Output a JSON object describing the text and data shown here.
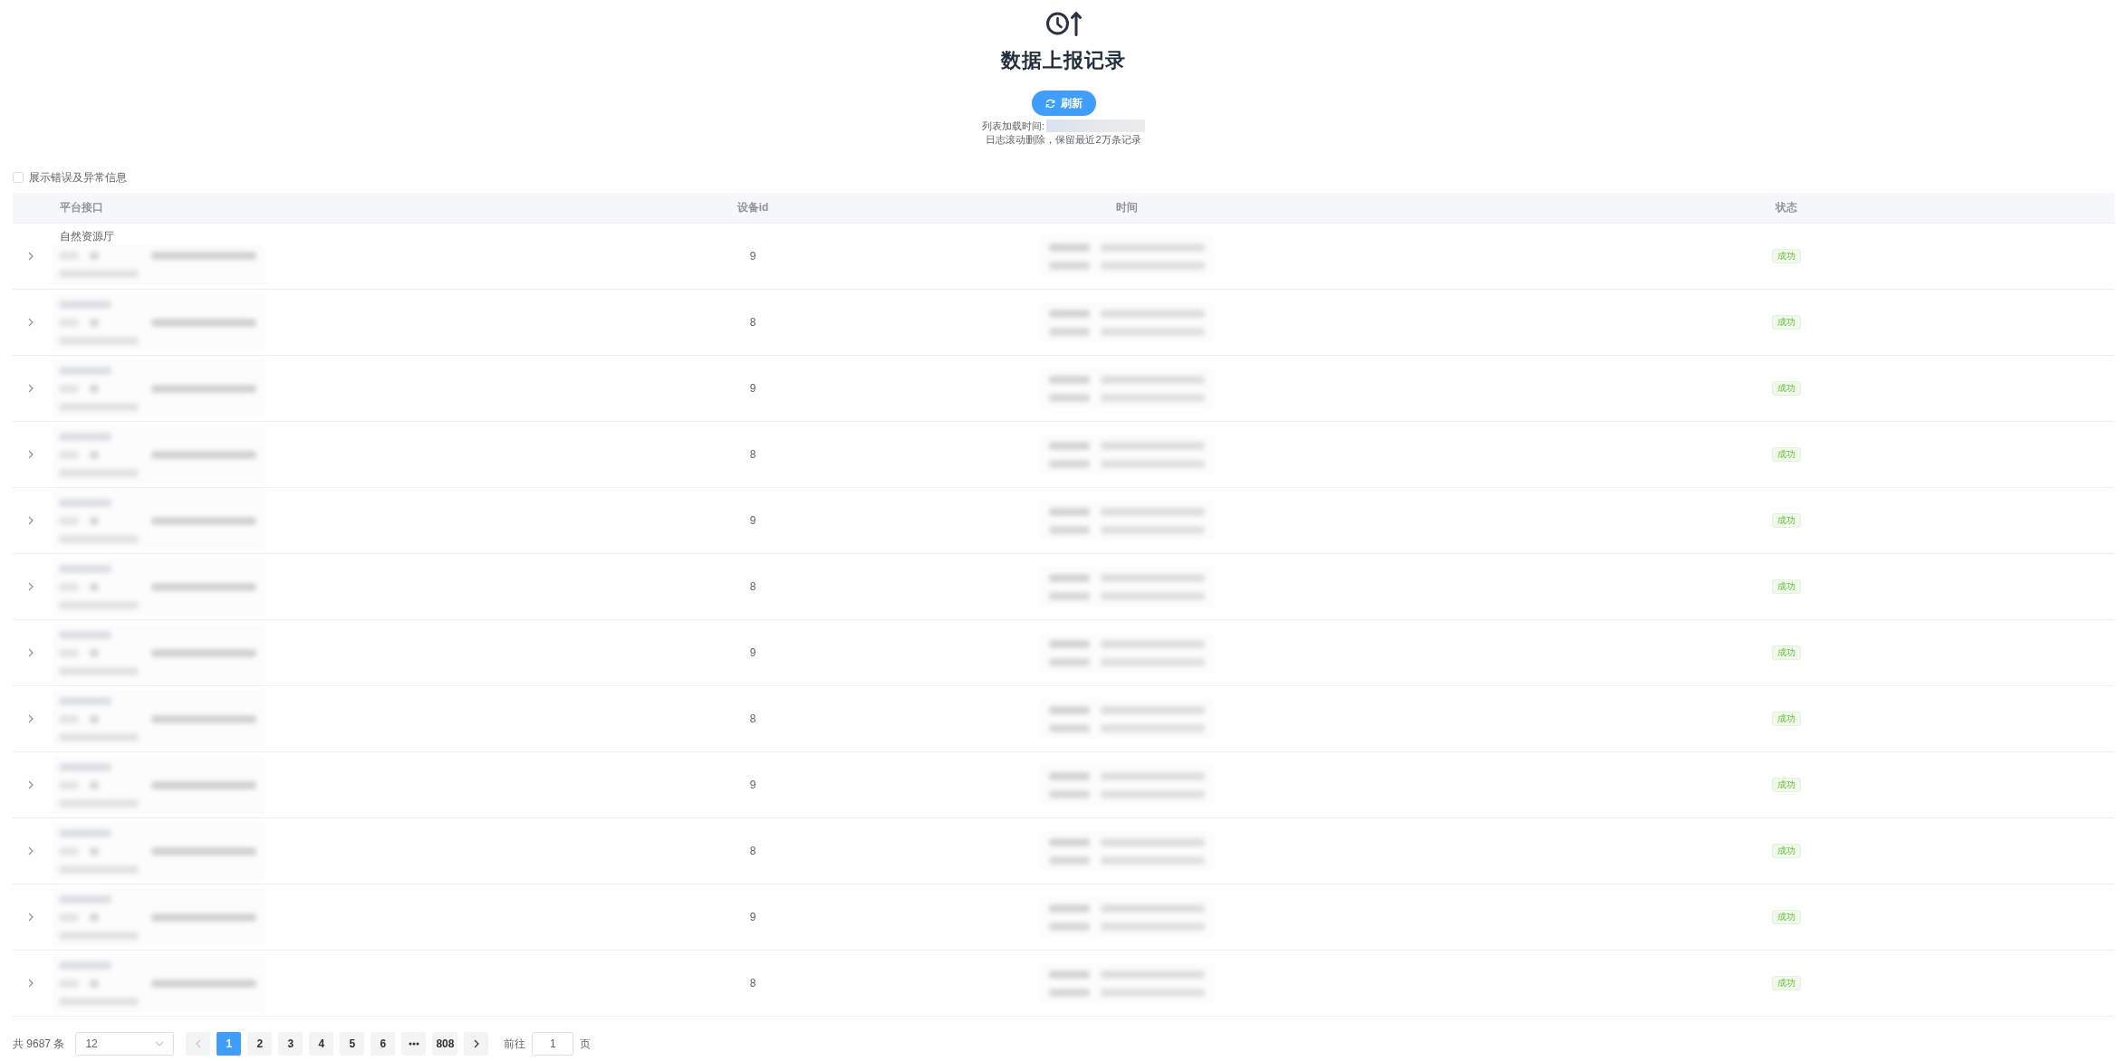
{
  "header": {
    "title": "数据上报记录",
    "refresh_button": "刷新",
    "load_time_label": "列表加载时间:",
    "note": "日志滚动删除，保留最近2万条记录"
  },
  "filter": {
    "label": "展示错误及异常信息",
    "checked": false
  },
  "table": {
    "columns": [
      "平台接口",
      "设备id",
      "时间",
      "状态"
    ],
    "rows": [
      {
        "expanded": false,
        "platform": "自然资源厅",
        "device_id": "9",
        "status": "成功"
      },
      {
        "expanded": false,
        "device_id": "8",
        "status": "成功"
      },
      {
        "expanded": false,
        "device_id": "9",
        "status": "成功"
      },
      {
        "expanded": false,
        "device_id": "8",
        "status": "成功"
      },
      {
        "expanded": false,
        "device_id": "9",
        "status": "成功"
      },
      {
        "expanded": false,
        "device_id": "8",
        "status": "成功"
      },
      {
        "expanded": false,
        "device_id": "9",
        "status": "成功"
      },
      {
        "expanded": false,
        "device_id": "8",
        "status": "成功"
      },
      {
        "expanded": false,
        "device_id": "9",
        "status": "成功"
      },
      {
        "expanded": false,
        "device_id": "8",
        "status": "成功"
      },
      {
        "expanded": false,
        "device_id": "9",
        "status": "成功"
      },
      {
        "expanded": false,
        "device_id": "8",
        "status": "成功"
      }
    ]
  },
  "pagination": {
    "total": "共 9687 条",
    "page_size": "12",
    "prev": {
      "disabled": true
    },
    "pages": [
      {
        "kind": "page",
        "label": "1",
        "selected": true
      },
      {
        "kind": "page",
        "label": "2",
        "selected": false
      },
      {
        "kind": "page",
        "label": "3",
        "selected": false
      },
      {
        "kind": "page",
        "label": "4",
        "selected": false
      },
      {
        "kind": "page",
        "label": "5",
        "selected": false
      },
      {
        "kind": "page",
        "label": "6",
        "selected": false
      },
      {
        "kind": "more",
        "selected": false
      },
      {
        "kind": "page",
        "label": "808",
        "selected": false
      }
    ],
    "next": {
      "disabled": false
    },
    "goto_label": "前往",
    "goto_value": "1",
    "goto_suffix": "页"
  }
}
